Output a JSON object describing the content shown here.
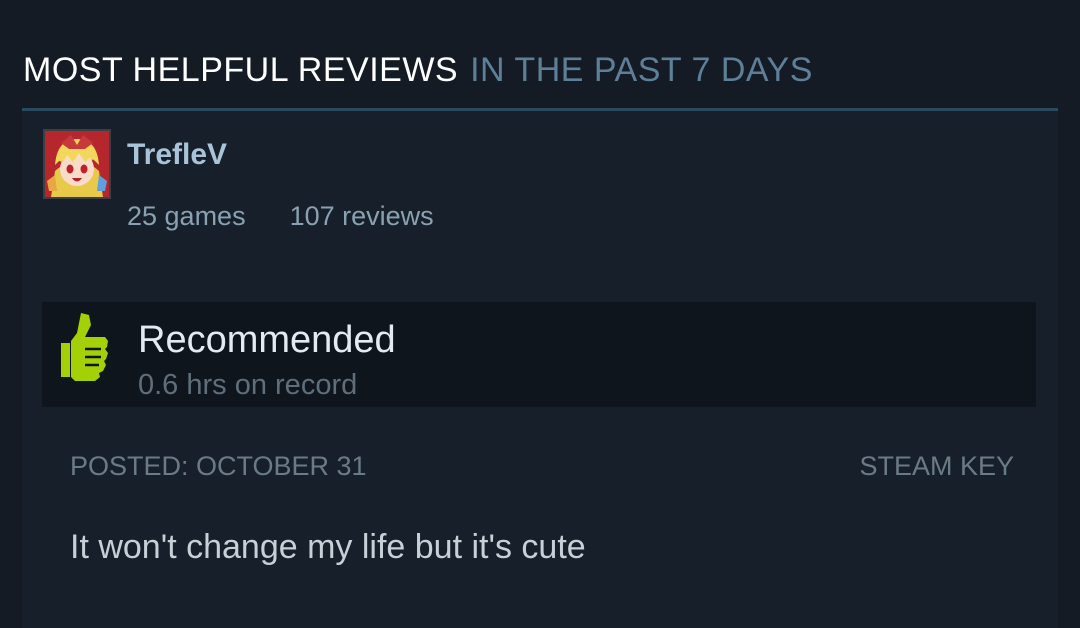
{
  "header": {
    "title": "MOST HELPFUL REVIEWS",
    "subtitle": "IN THE PAST 7 DAYS"
  },
  "review": {
    "author": {
      "name": "TrefleV",
      "games": "25 games",
      "reviews": "107 reviews",
      "avatar_icon": "anime-avatar-icon"
    },
    "vote": {
      "label": "Recommended",
      "hours": "0.6 hrs on record",
      "icon": "thumbs-up-icon",
      "icon_color": "#a4d007"
    },
    "posted": "POSTED: OCTOBER 31",
    "source": "STEAM KEY",
    "text": "It won't change my life but it's cute"
  },
  "colors": {
    "background": "#141b24",
    "card": "#161f2a",
    "vote_box": "#0f151d",
    "accent_rule": "#2a4a60",
    "username": "#a9c4d8"
  }
}
